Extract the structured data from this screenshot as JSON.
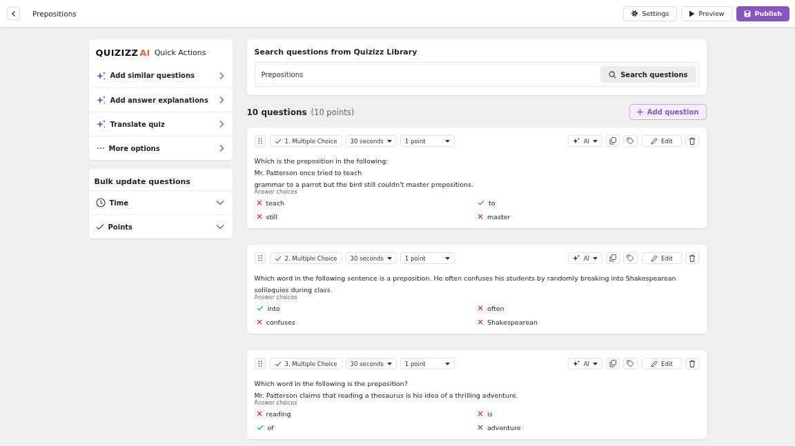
{
  "header": {
    "title": "Prepositions",
    "buttons": [
      {
        "label": "Settings",
        "kind": "settings"
      },
      {
        "label": "Preview",
        "kind": "preview"
      },
      {
        "label": "Publish",
        "kind": "publish"
      }
    ]
  },
  "quick_actions": {
    "logo": "QUIZIZZ",
    "logo_ai": "AI",
    "title": "Quick Actions",
    "items": [
      {
        "label": "Add similar questions",
        "kind": "ai"
      },
      {
        "label": "Add answer explanations",
        "kind": "ai"
      },
      {
        "label": "Translate quiz",
        "kind": "ai"
      },
      {
        "label": "More options",
        "kind": "more"
      }
    ]
  },
  "bulk_update": {
    "title": "Bulk update questions",
    "items": [
      {
        "label": "Time",
        "kind": "time"
      },
      {
        "label": "Points",
        "kind": "points"
      }
    ]
  },
  "search": {
    "title": "Search questions from Quizizz Library",
    "value": "Prepositions",
    "button": "Search questions"
  },
  "summary": {
    "count": "10 questions",
    "points": "(10 points)",
    "add_button": "Add question"
  },
  "questions": [
    {
      "type": "1. Multiple Choice",
      "time": "30 seconds",
      "points": "1 point",
      "ai": "AI",
      "edit": "Edit",
      "lines": [
        "Which is the preposition in the following:",
        "Mr. Patterson once tried to teach",
        "grammar to a parrot but the bird still couldn't master prepositions."
      ],
      "choices_label": "Answer choices",
      "choices": [
        {
          "text": "teach",
          "correct": false
        },
        {
          "text": "to",
          "correct": true
        },
        {
          "text": "still",
          "correct": false
        },
        {
          "text": "master",
          "correct": false
        }
      ]
    },
    {
      "type": "2. Multiple Choice",
      "time": "30 seconds",
      "points": "1 point",
      "ai": "AI",
      "edit": "Edit",
      "lines": [
        "Which word in the following sentence is a preposition. He often confuses his students by randomly breaking into Shakespearean soliloquies during class."
      ],
      "choices_label": "Answer choices",
      "choices": [
        {
          "text": "into",
          "correct": true
        },
        {
          "text": "often",
          "correct": false
        },
        {
          "text": "confuses",
          "correct": false
        },
        {
          "text": "Shakespearean",
          "correct": false
        }
      ]
    },
    {
      "type": "3. Multiple Choice",
      "time": "30 seconds",
      "points": "1 point",
      "ai": "AI",
      "edit": "Edit",
      "lines": [
        "Which word in the following is the preposition?",
        "Mr. Patterson claims that reading a thesaurus is his idea of a thrilling adventure."
      ],
      "choices_label": "Answer choices",
      "choices": [
        {
          "text": "reading",
          "correct": false
        },
        {
          "text": "is",
          "correct": false
        },
        {
          "text": "of",
          "correct": true
        },
        {
          "text": "adventure",
          "correct": false
        }
      ]
    }
  ]
}
